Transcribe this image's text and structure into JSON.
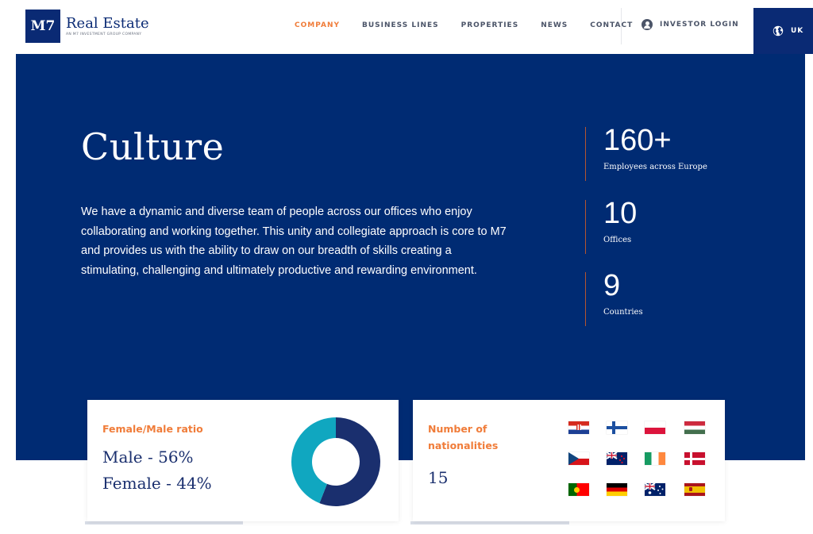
{
  "brand": {
    "name": "Real Estate",
    "mark": "M7",
    "tagline": "AN M7 INVESTMENT GROUP COMPANY",
    "accent_color": "#f07c39",
    "primary_color": "#002b73"
  },
  "nav": {
    "items": [
      {
        "label": "COMPANY",
        "active": true
      },
      {
        "label": "BUSINESS LINES",
        "active": false
      },
      {
        "label": "PROPERTIES",
        "active": false
      },
      {
        "label": "NEWS",
        "active": false
      },
      {
        "label": "CONTACT",
        "active": false
      }
    ],
    "investor_login": "INVESTOR LOGIN",
    "language": "UK",
    "icons": {
      "investor": "user-circle-icon",
      "language": "globe-icon"
    }
  },
  "hero": {
    "title": "Culture",
    "description": "We have a dynamic and diverse team of people across our offices who enjoy collaborating and working together. This unity and collegiate approach is core to M7 and provides us with the ability to draw on our breadth of skills creating a stimulating, challenging and ultimately productive and rewarding environment.",
    "stats": [
      {
        "number": "160+",
        "label": "Employees across Europe"
      },
      {
        "number": "10",
        "label": "Offices"
      },
      {
        "number": "9",
        "label": "Countries"
      }
    ]
  },
  "ratio_card": {
    "title": "Female/Male ratio",
    "male": "Male - 56%",
    "female": "Female - 44%",
    "male_pct": 56,
    "female_pct": 44,
    "male_color": "#1a2f6e",
    "female_color": "#10a7c0"
  },
  "nationalities_card": {
    "title_line1": "Number of",
    "title_line2": "nationalities",
    "count": "15",
    "flags": [
      "croatia-flag",
      "finland-flag",
      "poland-flag",
      "hungary-flag",
      "czech-flag",
      "new-zealand-flag",
      "ireland-flag",
      "denmark-flag",
      "portugal-flag",
      "germany-flag",
      "australia-flag",
      "spain-flag"
    ]
  }
}
